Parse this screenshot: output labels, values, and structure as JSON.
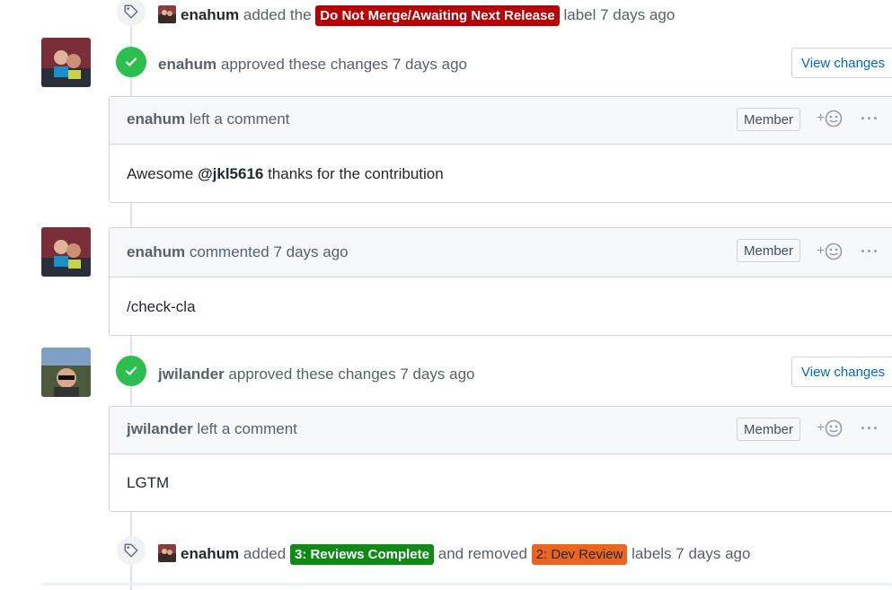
{
  "events": {
    "label_added": {
      "user": "enahum",
      "text_a": "added the",
      "label": "Do Not Merge/Awaiting Next Release",
      "label_color": "#b60205",
      "text_b": "label 7 days ago"
    },
    "labels_changed": {
      "user": "enahum",
      "text_a": "added",
      "added_label": "3: Reviews Complete",
      "added_color": "#0e8a16",
      "text_b": "and removed",
      "removed_label": "2: Dev Review",
      "removed_color": "#eb6420",
      "text_c": "labels 7 days ago"
    }
  },
  "reviews": [
    {
      "user": "enahum",
      "action": "approved these changes 7 days ago",
      "view_changes": "View changes",
      "comment_user": "enahum",
      "comment_action": "left a comment",
      "member": "Member",
      "body_pre": "Awesome ",
      "body_mention": "@jkl5616",
      "body_post": " thanks for the contribution"
    },
    {
      "user": "jwilander",
      "action": "approved these changes 7 days ago",
      "view_changes": "View changes",
      "comment_user": "jwilander",
      "comment_action": "left a comment",
      "member": "Member",
      "body": "LGTM"
    }
  ],
  "comment": {
    "user": "enahum",
    "action": "commented 7 days ago",
    "member": "Member",
    "body": "/check-cla"
  },
  "reaction_plus": "+",
  "more_glyph": "···",
  "colors": {
    "approved": "#2cbe4e",
    "link": "#0366d6"
  }
}
